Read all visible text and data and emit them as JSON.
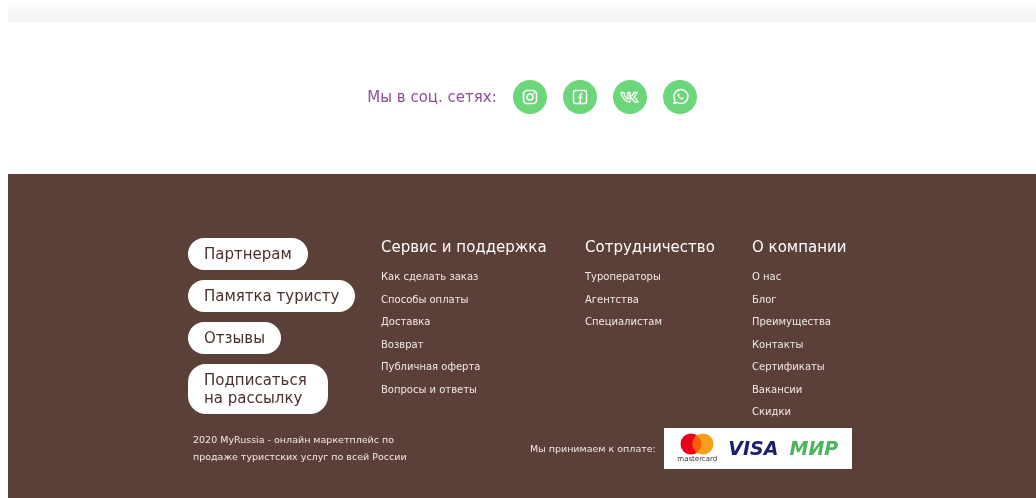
{
  "social": {
    "label": "Мы в соц. сетях:",
    "icons": [
      {
        "kind": "instagram"
      },
      {
        "kind": "facebook"
      },
      {
        "kind": "vk"
      },
      {
        "kind": "whatsapp"
      }
    ]
  },
  "footer": {
    "buttons": [
      "Партнерам",
      "Памятка туристу",
      "Отзывы",
      "Подписаться на рассылку"
    ],
    "columns": [
      {
        "title": "Сервис и поддержка",
        "links": [
          "Как сделать заказ",
          "Способы оплаты",
          "Доставка",
          "Возврат",
          "Публичная оферта",
          "Вопросы и ответы"
        ]
      },
      {
        "title": "Сотрудничество",
        "links": [
          "Туроператоры",
          "Агентства",
          "Специалистам"
        ]
      },
      {
        "title": "О компании",
        "links": [
          "О нас",
          "Блог",
          "Преимущества",
          "Контакты",
          "Сертификаты",
          "Вакансии",
          "Скидки"
        ]
      }
    ],
    "copyright": "2020 MyRussia - онлайн маркетплейс по продаже туристских услуг по всей России",
    "payment_label": "Мы принимаем к оплате:",
    "payment_logos": [
      {
        "kind": "mastercard",
        "text": "mastercard"
      },
      {
        "kind": "visa",
        "text": "VISA"
      },
      {
        "kind": "mir",
        "text": "МИР"
      }
    ]
  }
}
